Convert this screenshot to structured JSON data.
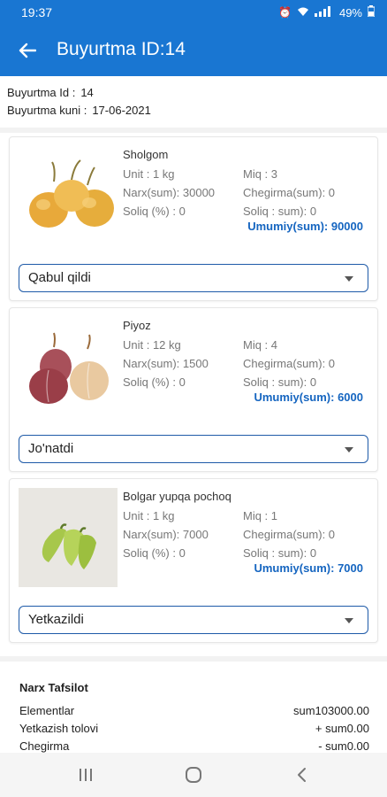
{
  "status_bar": {
    "time": "19:37",
    "battery": "49%",
    "icons": [
      "alarm-icon",
      "wifi-icon",
      "signal-icon",
      "battery-icon"
    ]
  },
  "app_bar": {
    "title": "Buyurtma ID:14",
    "back_icon": "arrow-left-icon"
  },
  "order": {
    "id_label": "Buyurtma Id :",
    "id_value": "14",
    "date_label": "Buyurtma kuni :",
    "date_value": "17-06-2021"
  },
  "items": [
    {
      "name": "Sholgom",
      "unit": "Unit : 1 kg",
      "price": "Narx(sum): 30000",
      "tax": "Soliq (%) : 0",
      "qty": "Miq : 3",
      "discount": "Chegirma(sum): 0",
      "tax_sum": "Soliq : sum): 0",
      "total": "Umumiy(sum): 90000",
      "status": "Qabul qildi",
      "image": "turnip-image"
    },
    {
      "name": "Piyoz",
      "unit": "Unit : 12 kg",
      "price": "Narx(sum): 1500",
      "tax": "Soliq (%) : 0",
      "qty": "Miq : 4",
      "discount": "Chegirma(sum): 0",
      "tax_sum": "Soliq : sum): 0",
      "total": "Umumiy(sum): 6000",
      "status": "Jo'natdi",
      "image": "onion-image"
    },
    {
      "name": "Bolgar yupqa pochoq",
      "unit": "Unit : 1 kg",
      "price": "Narx(sum): 7000",
      "tax": "Soliq (%) : 0",
      "qty": "Miq : 1",
      "discount": "Chegirma(sum): 0",
      "tax_sum": "Soliq : sum): 0",
      "total": "Umumiy(sum): 7000",
      "status": "Yetkazildi",
      "image": "pepper-image"
    }
  ],
  "summary": {
    "title": "Narx Tafsilot",
    "rows": [
      {
        "label": "Elementlar",
        "amount": "sum103000.00"
      },
      {
        "label": "Yetkazish tolovi",
        "amount": "+ sum0.00"
      },
      {
        "label": "Chegirma",
        "amount": "- sum0.00"
      }
    ]
  },
  "nav_bar": {
    "icons": [
      "recent-apps-icon",
      "home-icon",
      "back-icon"
    ]
  },
  "colors": {
    "primary": "#1976d2",
    "total_text": "#1565c0",
    "select_border": "#1e5aa8"
  }
}
